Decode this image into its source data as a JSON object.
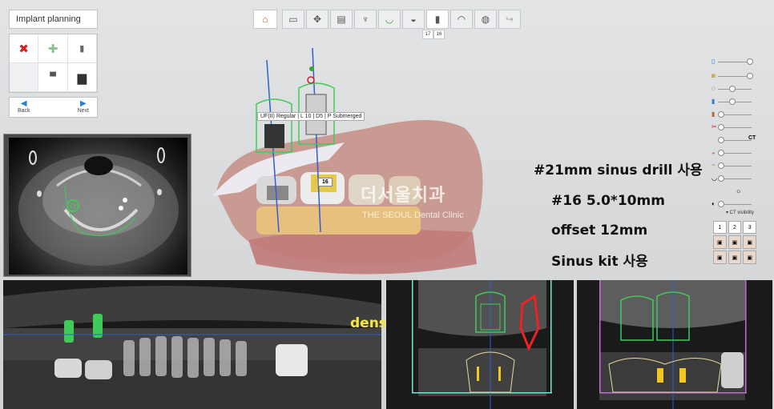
{
  "panel": {
    "title": "Implant planning",
    "back_label": "Back",
    "next_label": "Next",
    "tools": [
      {
        "icon": "delete-x-icon",
        "glyph": "✖"
      },
      {
        "icon": "add-plus-icon",
        "glyph": "✚"
      },
      {
        "icon": "implant-icon",
        "glyph": "▮"
      },
      {
        "icon": "blank",
        "glyph": ""
      },
      {
        "icon": "abutment-icon",
        "glyph": "▝▘"
      },
      {
        "icon": "sleeve-icon",
        "glyph": "▆"
      }
    ]
  },
  "toolbar": {
    "tooth_tabs": [
      "17",
      "16"
    ]
  },
  "implant_label": "UF(II) Regular | L 10 | D5 | P Submerged",
  "tooth_marker": "16",
  "watermark": {
    "main": "더서울치과",
    "sub": "THE SEOUL Dental Clinic"
  },
  "annotations": {
    "drill": "#21mm sinus drill 사용",
    "size": "#16 5.0*10mm",
    "offset": "offset 12mm",
    "kit": "Sinus kit 사용",
    "density": "density 확인"
  },
  "visibility": {
    "ct_label": "CT",
    "ct_visibility_label": "▾ CT visibility",
    "ct_grid": [
      "1",
      "2",
      "3"
    ]
  },
  "colors": {
    "accent_blue": "#2d7fd0",
    "delete_red": "#d62020",
    "implant_green": "#3ecb5a",
    "density_yellow": "#f6e64a",
    "cross2_frame": "#c86ad9",
    "cross1_frame": "#74e6d2"
  }
}
